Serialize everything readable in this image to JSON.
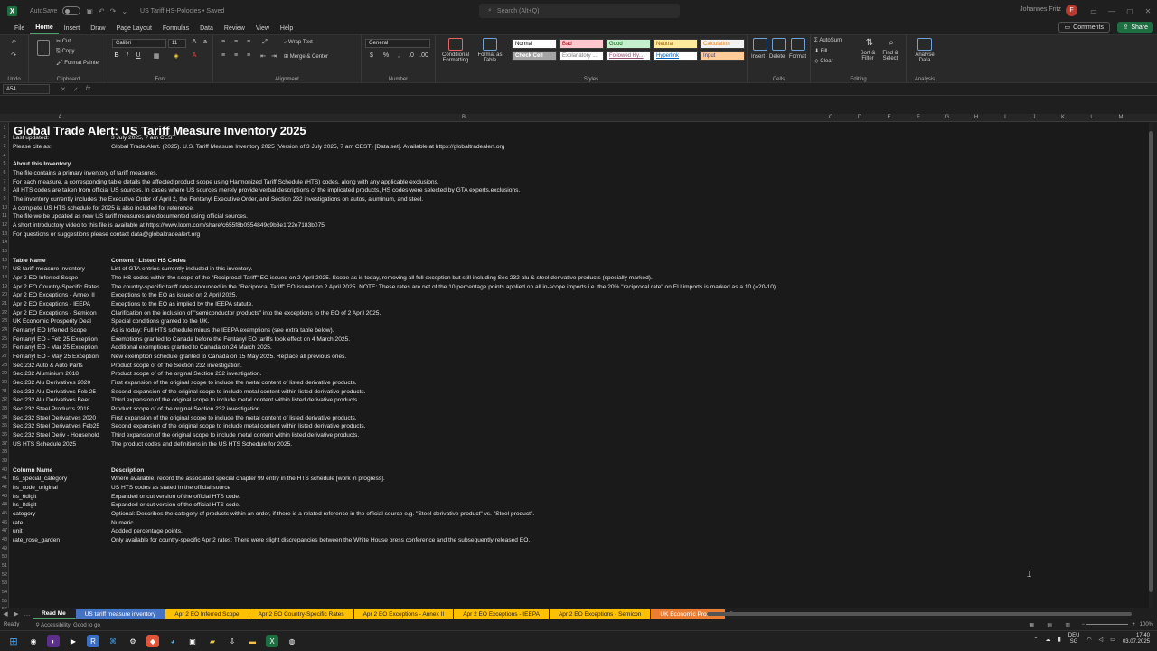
{
  "app": {
    "autosave_label": "AutoSave",
    "autosave_state": "Off",
    "doc_title": "US Tariff HS-Polocies • Saved",
    "search_placeholder": "Search (Alt+Q)",
    "user_name": "Johannes Fritz",
    "user_initials": "F"
  },
  "menu": {
    "items": [
      "File",
      "Home",
      "Insert",
      "Draw",
      "Page Layout",
      "Formulas",
      "Data",
      "Review",
      "View",
      "Help"
    ],
    "active": "Home",
    "comments_label": "Comments",
    "share_label": "Share"
  },
  "ribbon": {
    "undo_label": "Undo",
    "clipboard": {
      "cut": "Cut",
      "copy": "Copy",
      "format_painter": "Format Painter",
      "label": "Clipboard"
    },
    "font": {
      "name": "Calibri",
      "size": "11",
      "label": "Font"
    },
    "alignment": {
      "wrap": "Wrap Text",
      "merge": "Merge & Center",
      "label": "Alignment"
    },
    "number": {
      "format": "General",
      "label": "Number"
    },
    "styles": {
      "conditional": "Conditional Formatting",
      "format_table": "Format as Table",
      "cells": [
        {
          "label": "Normal",
          "bg": "#ffffff",
          "fg": "#000000"
        },
        {
          "label": "Bad",
          "bg": "#ffc7ce",
          "fg": "#9c0006"
        },
        {
          "label": "Good",
          "bg": "#c6efce",
          "fg": "#006100"
        },
        {
          "label": "Neutral",
          "bg": "#ffeb9c",
          "fg": "#9c5700"
        },
        {
          "label": "Calculation",
          "bg": "#f2f2f2",
          "fg": "#fa7d00"
        },
        {
          "label": "Check Cell",
          "bg": "#a5a5a5",
          "fg": "#ffffff"
        },
        {
          "label": "Explanatory ...",
          "bg": "#ffffff",
          "fg": "#7f7f7f"
        },
        {
          "label": "Followed Hy...",
          "bg": "#ffffff",
          "fg": "#954f72"
        },
        {
          "label": "Hyperlink",
          "bg": "#ffffff",
          "fg": "#0563c1"
        },
        {
          "label": "Input",
          "bg": "#ffcc99",
          "fg": "#3f3f76"
        }
      ],
      "label": "Styles"
    },
    "cells": {
      "insert": "Insert",
      "delete": "Delete",
      "format": "Format",
      "label": "Cells"
    },
    "editing": {
      "autosum": "AutoSum",
      "fill": "Fill",
      "clear": "Clear",
      "sort": "Sort & Filter",
      "find": "Find & Select",
      "label": "Editing"
    },
    "analysis": {
      "analyse": "Analyse Data",
      "label": "Analysis"
    }
  },
  "formula_bar": {
    "cell_ref": "A54",
    "fx": "fx",
    "value": ""
  },
  "columns": [
    "A",
    "B",
    "C",
    "D",
    "E",
    "F",
    "G",
    "H",
    "I",
    "J",
    "K",
    "L",
    "M"
  ],
  "sheet": {
    "title": "Global Trade Alert: US Tariff Measure Inventory 2025",
    "rows": [
      {
        "r": 2,
        "a": "Last updated:",
        "b": "3 July 2025, 7 am CEST"
      },
      {
        "r": 3,
        "a": "Please cite as:",
        "b": "Global Trade Alert. (2025). U.S. Tariff Measure Inventory 2025 (Version of 3 July 2025, 7 am CEST) [Data set]. Available at https://globaltradealert.org"
      },
      {
        "r": 5,
        "a": "About this Inventory",
        "b": "",
        "bold": true
      },
      {
        "r": 6,
        "a": "The file contains a primary inventory of tariff measures.",
        "b": ""
      },
      {
        "r": 7,
        "a": "For each measure, a corresponding table details the affected product scope using Harmonized Tariff Schedule (HTS) codes, along with any applicable exclusions.",
        "b": ""
      },
      {
        "r": 8,
        "a": "All HTS codes are taken from official US sources. In cases where US sources merely provide verbal descriptions of the implicated products, HS codes were selected by GTA experts.exclusions.",
        "b": ""
      },
      {
        "r": 9,
        "a": "The inventory currently includes the Executive Order of April 2, the Fentanyl Executive Order, and Section 232 investigations on autos, aluminum, and steel.",
        "b": ""
      },
      {
        "r": 10,
        "a": "A complete US HTS schedule for 2025 is also included for reference.",
        "b": ""
      },
      {
        "r": 11,
        "a": "The file we be updated as new US tariff measures are documented using official sources.",
        "b": ""
      },
      {
        "r": 12,
        "a": "A short introductory video to this file is available at https://www.loom.com/share/c655f8b0554849c9b3e1f22e7183b075",
        "b": ""
      },
      {
        "r": 13,
        "a": "For questions or suggestions please contact data@globaltradealert.org",
        "b": ""
      },
      {
        "r": 16,
        "a": "Table Name",
        "b": "Content / Listed HS Codes",
        "bold": true
      },
      {
        "r": 17,
        "a": "US tariff measure inventory",
        "b": "List of GTA entries currently included in this inventory."
      },
      {
        "r": 18,
        "a": "Apr 2 EO Inferred Scope",
        "b": "The HS codes within the scope of the \"Reciprocal Tariff\" EO issued on 2 April 2025. Scope as is today, removing all full exception but still including Sec 232 alu & steel derivative products (specially marked)."
      },
      {
        "r": 19,
        "a": "Apr 2 EO Country-Specific Rates",
        "b": "The country-specific tariff rates anounced in the \"Reciprocal Tariff\" EO issued on 2 April 2025. NOTE: These rates are net of the 10 percentage points applied on all in-scope imports i.e. the 20% \"reciprocal rate\" on EU imports is marked as a 10 (=20-10)."
      },
      {
        "r": 20,
        "a": "Apr 2 EO Exceptions - Annex II",
        "b": "Exceptions to the EO as issued on 2 April 2025."
      },
      {
        "r": 21,
        "a": "Apr 2 EO Exceptions - IEEPA",
        "b": "Exceptions to the EO as implied by the IEEPA statute."
      },
      {
        "r": 22,
        "a": "Apr 2 EO Exceptions - Semicon",
        "b": "Clarification on the inclusion of \"semiconductor products\" into the exceptions to the EO of 2 April 2025."
      },
      {
        "r": 23,
        "a": "UK Economic Prosperity Deal",
        "b": "Special conditions granted to the UK."
      },
      {
        "r": 24,
        "a": "Fentanyl EO Inferred Scope",
        "b": "As is today: Full HTS schedule minus the IEEPA exemptions (see extra table below)."
      },
      {
        "r": 25,
        "a": "Fentanyl EO - Feb 25 Exception",
        "b": "Exemptions granted to Canada before the Fentanyl EO tariffs took effect on 4 March 2025."
      },
      {
        "r": 26,
        "a": "Fentanyl EO - Mar 25 Exception",
        "b": "Additional exemptions granted to Canada on 24 March 2025."
      },
      {
        "r": 27,
        "a": "Fentanyl EO - May 25 Exception",
        "b": "New exemption schedule granted to Canada on 15 May 2025. Replace all previous ones."
      },
      {
        "r": 28,
        "a": "Sec 232 Auto & Auto Parts",
        "b": "Product scope of of the Section 232 investigation."
      },
      {
        "r": 29,
        "a": "Sec 232 Aluminium 2018",
        "b": "Product scope of of the orginal Section 232 investigation."
      },
      {
        "r": 30,
        "a": "Sec 232 Alu Derivatives 2020",
        "b": "First expansion of the original scope to include the metal content of listed derivative products."
      },
      {
        "r": 31,
        "a": "Sec 232 Alu Derivatives Feb 25",
        "b": "Second expansion of the original scope to include metal content within listed derivative products."
      },
      {
        "r": 32,
        "a": "Sec 232 Alu Derivatives Beer",
        "b": "Third expansion of the original scope to include metal content within listed derivative products."
      },
      {
        "r": 33,
        "a": "Sec 232 Steel Products 2018",
        "b": "Product scope of of the orginal Section 232 investigation."
      },
      {
        "r": 34,
        "a": "Sec 232 Steel Derivatives 2020",
        "b": "First expansion of the original scope to include the metal content of listed derivative products."
      },
      {
        "r": 35,
        "a": "Sec 232 Steel Derivatives Feb25",
        "b": "Second expansion of the original scope to include metal content within listed derivative products."
      },
      {
        "r": 36,
        "a": "Sec 232 Steel Deriv - Household",
        "b": "Third expansion of the original scope to include metal content within listed derivative products."
      },
      {
        "r": 37,
        "a": "US HTS Schedule 2025",
        "b": "The product codes and definitions in the US HTS Schedule for 2025."
      },
      {
        "r": 40,
        "a": "Column Name",
        "b": "Description",
        "bold": true
      },
      {
        "r": 41,
        "a": "hs_special_category",
        "b": "Where available, record the associated special chapter 99 entry in the HTS schedule [work in progress]."
      },
      {
        "r": 42,
        "a": "hs_code_original",
        "b": "US HTS codes as stated in the official source"
      },
      {
        "r": 43,
        "a": "hs_6digit",
        "b": "Expanded or cut version of the official HTS code."
      },
      {
        "r": 44,
        "a": "hs_8digit",
        "b": "Expanded or cut version of the official HTS code."
      },
      {
        "r": 45,
        "a": "category",
        "b": "Optional: Describes the category of products within an order, if there is a related reference in the official source e.g. \"Steel derivative product\" vs. \"Steel product\"."
      },
      {
        "r": 46,
        "a": "rate",
        "b": "Numeric."
      },
      {
        "r": 47,
        "a": "unit",
        "b": "Addded percentage points."
      },
      {
        "r": 48,
        "a": "rate_rose_garden",
        "b": "Only available for country-specific Apr 2 rates: There were slight discrepancies between the White House press conference and the subsequently released EO."
      }
    ]
  },
  "tabs": [
    {
      "label": "Read Me",
      "color": "#1f1f1f",
      "active": true
    },
    {
      "label": "US tariff measure inventory",
      "color": "#4472c4"
    },
    {
      "label": "Apr 2 EO Inferred Scope",
      "color": "#ffc000"
    },
    {
      "label": "Apr 2 EO Country-Specific Rates",
      "color": "#ffc000"
    },
    {
      "label": "Apr 2 EO Exceptions - Annex II",
      "color": "#ffc000"
    },
    {
      "label": "Apr 2 EO Exceptions - IEEPA",
      "color": "#ffc000"
    },
    {
      "label": "Apr 2 EO Exceptions - Semicon",
      "color": "#ffc000"
    },
    {
      "label": "UK Economic Prospe",
      "color": "#ed7d31"
    }
  ],
  "status": {
    "ready": "Ready",
    "accessibility": "Accessibility: Good to go",
    "zoom": "100%"
  },
  "taskbar": {
    "lang": "DEU",
    "region": "SG",
    "time": "17:40",
    "date": "03.07.2025"
  }
}
